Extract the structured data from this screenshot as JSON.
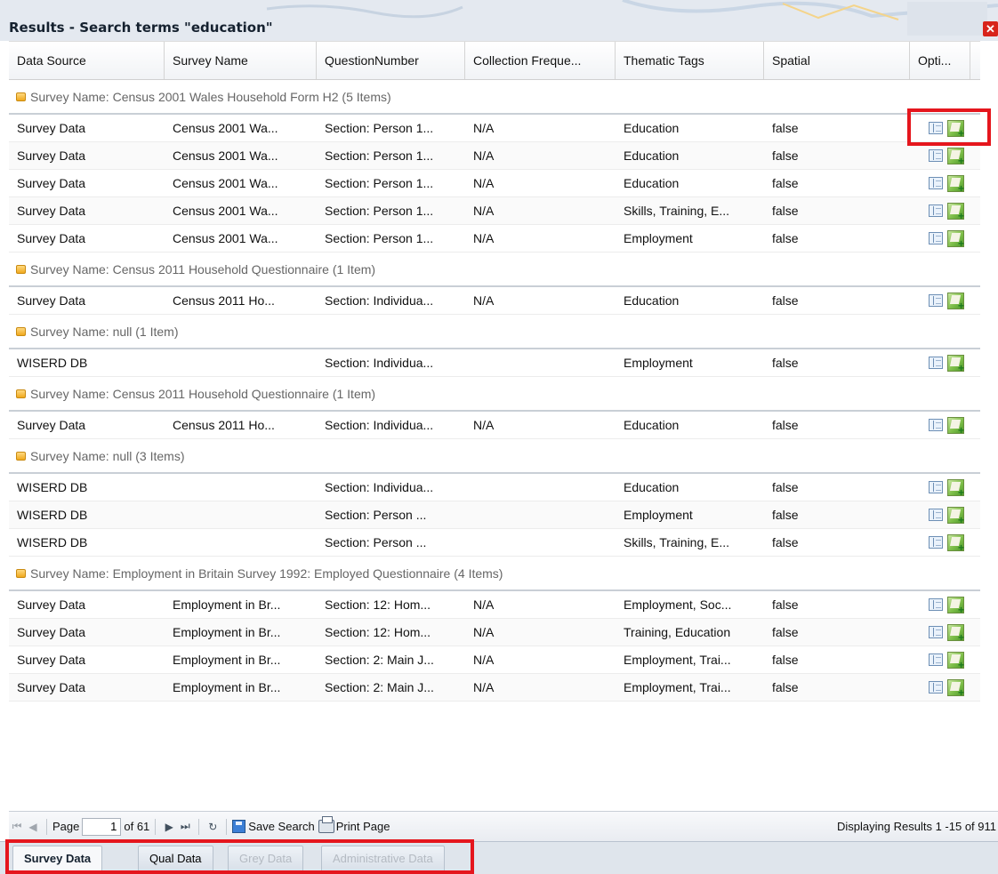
{
  "window": {
    "title": "Results - Search terms \"education\"",
    "close_icon": "close-icon"
  },
  "columns": [
    "Data Source",
    "Survey Name",
    "QuestionNumber",
    "Collection Freque...",
    "Thematic Tags",
    "Spatial",
    "Opti..."
  ],
  "groups": [
    {
      "label": "Survey Name: Census 2001 Wales Household Form H2 (5 Items)",
      "rows": [
        [
          "Survey Data",
          "Census 2001 Wa...",
          "Section: Person 1...",
          "N/A",
          "Education",
          "false"
        ],
        [
          "Survey Data",
          "Census 2001 Wa...",
          "Section: Person 1...",
          "N/A",
          "Education",
          "false"
        ],
        [
          "Survey Data",
          "Census 2001 Wa...",
          "Section: Person 1...",
          "N/A",
          "Education",
          "false"
        ],
        [
          "Survey Data",
          "Census 2001 Wa...",
          "Section: Person 1...",
          "N/A",
          "Skills, Training, E...",
          "false"
        ],
        [
          "Survey Data",
          "Census 2001 Wa...",
          "Section: Person 1...",
          "N/A",
          "Employment",
          "false"
        ]
      ]
    },
    {
      "label": "Survey Name: Census 2011 Household Questionnaire (1 Item)",
      "rows": [
        [
          "Survey Data",
          "Census 2011 Ho...",
          "Section: Individua...",
          "N/A",
          "Education",
          "false"
        ]
      ]
    },
    {
      "label": "Survey Name: null (1 Item)",
      "rows": [
        [
          "WISERD DB",
          "",
          "Section: Individua...",
          "",
          "Employment",
          "false"
        ]
      ]
    },
    {
      "label": "Survey Name: Census 2011 Household Questionnaire (1 Item)",
      "rows": [
        [
          "Survey Data",
          "Census 2011 Ho...",
          "Section: Individua...",
          "N/A",
          "Education",
          "false"
        ]
      ]
    },
    {
      "label": "Survey Name: null (3 Items)",
      "rows": [
        [
          "WISERD DB",
          "",
          "Section: Individua...",
          "",
          "Education",
          "false"
        ],
        [
          "WISERD DB",
          "",
          "Section: Person ...",
          "",
          "Employment",
          "false"
        ],
        [
          "WISERD DB",
          "",
          "Section: Person ...",
          "",
          "Skills, Training, E...",
          "false"
        ]
      ]
    },
    {
      "label": "Survey Name: Employment in Britain Survey 1992: Employed Questionnaire (4 Items)",
      "rows": [
        [
          "Survey Data",
          "Employment in Br...",
          "Section: 12: Hom...",
          "N/A",
          "Employment, Soc...",
          "false"
        ],
        [
          "Survey Data",
          "Employment in Br...",
          "Section: 12: Hom...",
          "N/A",
          "Training, Education",
          "false"
        ],
        [
          "Survey Data",
          "Employment in Br...",
          "Section: 2: Main J...",
          "N/A",
          "Employment, Trai...",
          "false"
        ],
        [
          "Survey Data",
          "Employment in Br...",
          "Section: 2: Main J...",
          "N/A",
          "Employment, Trai...",
          "false"
        ]
      ]
    }
  ],
  "row_icons": {
    "view": "view-details-icon",
    "map": "add-to-map-icon"
  },
  "paging": {
    "page_label": "Page",
    "page_value": "1",
    "of_total": "of 61",
    "save_search": "Save Search",
    "print_page": "Print Page",
    "display_count": "Displaying Results 1 -15 of 911"
  },
  "tabs": [
    {
      "label": "Survey Data",
      "state": "active"
    },
    {
      "label": "Qual Data",
      "state": "enabled"
    },
    {
      "label": "Grey Data",
      "state": "disabled"
    },
    {
      "label": "Administrative Data",
      "state": "disabled"
    }
  ],
  "colors": {
    "highlight": "#e5161d",
    "close_button": "#d8241b",
    "group_icon": "#f0a91e"
  }
}
